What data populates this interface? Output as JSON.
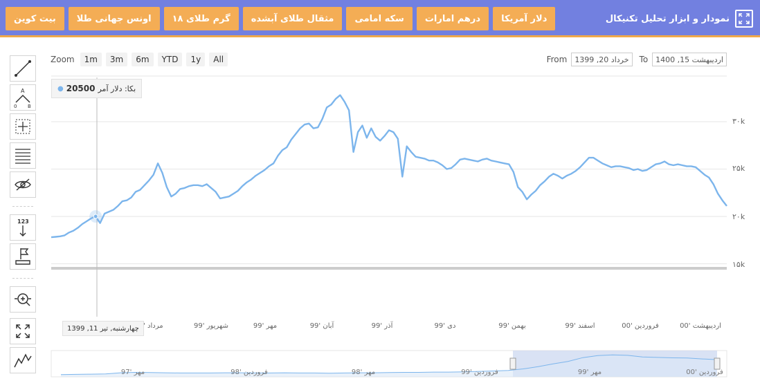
{
  "header": {
    "title": "نمودار و ابزار تحلیل تکنیکال",
    "tabs": [
      "دلار آمریکا",
      "درهم امارات",
      "سکه امامی",
      "مثقال طلای آبشده",
      "گرم طلای ۱۸",
      "اونس جهانی طلا",
      "بیت کوین"
    ],
    "active_tab": 0
  },
  "toolbar": {
    "tools": [
      "line-tool-icon",
      "abc-pattern-icon",
      "crosshair-measure-icon",
      "fibonacci-icon",
      "hide-drawings-icon",
      "price-label-icon",
      "flag-annotation-icon",
      "zoom-magnifier-icon",
      "fullscreen-icon",
      "chart-type-icon"
    ]
  },
  "range_selector": {
    "zoom_label": "Zoom",
    "buttons": [
      "1m",
      "3m",
      "6m",
      "YTD",
      "1y",
      "All"
    ],
    "from_label": "From",
    "from_value": "1399 ,20 خرداد",
    "to_label": "To",
    "to_value": "1400 ,15 اردیبهشت"
  },
  "tooltip": {
    "series": "بکا: دلار آمر",
    "value": "20500",
    "date": "چهارشنبه, تیر 11, 1399"
  },
  "chart_data": {
    "type": "line",
    "series": [
      {
        "name": "بکا: دلار آمر",
        "color": "#7cb5ec",
        "values": [
          17800,
          17850,
          17900,
          18000,
          18300,
          18500,
          18800,
          19200,
          19500,
          19800,
          20000,
          19300,
          20300,
          20500,
          20700,
          21100,
          21600,
          21700,
          22000,
          22600,
          22800,
          23300,
          23800,
          24400,
          25600,
          24600,
          23100,
          22100,
          22400,
          22900,
          23000,
          23200,
          23300,
          23300,
          23200,
          23400,
          23000,
          22600,
          21900,
          22000,
          22100,
          22400,
          22700,
          23200,
          23600,
          23900,
          24300,
          24600,
          24900,
          25300,
          25600,
          26400,
          27000,
          27300,
          28100,
          28700,
          29300,
          29700,
          29800,
          29300,
          29400,
          30300,
          31500,
          31800,
          32400,
          32800,
          32100,
          31200,
          26800,
          28900,
          29600,
          28300,
          29300,
          28400,
          28000,
          28500,
          29100,
          28900,
          28200,
          24200,
          27400,
          26800,
          26300,
          26200,
          26100,
          25900,
          25900,
          25700,
          25400,
          25000,
          25100,
          25500,
          26000,
          26100,
          26000,
          25900,
          25800,
          26000,
          26100,
          25900,
          25800,
          25700,
          25600,
          25500,
          24700,
          23100,
          22600,
          21800,
          22300,
          22700,
          23300,
          23700,
          24200,
          24500,
          24300,
          24000,
          24300,
          24500,
          24800,
          25200,
          25700,
          26200,
          26200,
          25900,
          25600,
          25400,
          25200,
          25300,
          25300,
          25200,
          25100,
          24900,
          25000,
          24800,
          24900,
          25200,
          25500,
          25600,
          25800,
          25500,
          25400,
          25500,
          25400,
          25300,
          25300,
          25200,
          24800,
          24400,
          24100,
          23400,
          22400,
          21700,
          21100
        ],
        "last_visible_value": 21100
      }
    ],
    "x_labels": [
      "مرداد '99",
      "شهریور '99",
      "مهر '99",
      "آبان '99",
      "آذر '99",
      "دی '99",
      "بهمن '99",
      "اسفند '99",
      "فروردین '00",
      "اردیبهشت '00"
    ],
    "y_ticks": [
      "۱۵k",
      "۲۰k",
      "۲۵k",
      "۳۰k"
    ],
    "y_tick_values": [
      15000,
      20000,
      25000,
      30000
    ],
    "ylim": [
      15000,
      33000
    ],
    "grid": true,
    "navigator_labels": [
      "مهر '97",
      "فروردین '98",
      "مهر '98",
      "فروردین '99",
      "مهر '99",
      "فروردین '00"
    ],
    "navigator_values": [
      14000,
      14100,
      14200,
      14300,
      14800,
      15000,
      14900,
      14800,
      14700,
      14700,
      14700,
      14800,
      14800,
      14700,
      14700,
      14800,
      14700,
      14700,
      14600,
      14700,
      14800,
      14800,
      14900,
      15000,
      15000,
      15100,
      15100,
      15200,
      15400,
      15600,
      15800,
      16500,
      17500,
      18700,
      19800,
      21500,
      22400,
      22700,
      22500,
      21800,
      21600,
      21400,
      21300,
      20900,
      20600
    ],
    "navigator_selection": [
      "1399 ,20 خرداد",
      "1400 ,15 اردیبهشت"
    ]
  }
}
